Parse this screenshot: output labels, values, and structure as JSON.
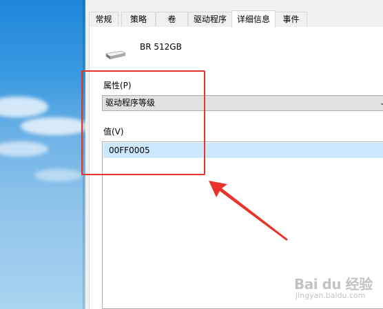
{
  "dialog": {
    "tabs": [
      {
        "label": "常规",
        "active": false
      },
      {
        "label": "策略",
        "active": false
      },
      {
        "label": "卷",
        "active": false
      },
      {
        "label": "驱动程序",
        "active": false
      },
      {
        "label": "详细信息",
        "active": true
      },
      {
        "label": "事件",
        "active": false
      }
    ],
    "device_name": "BR 512GB",
    "property_label": "属性(P)",
    "property_selected": "驱动程序等级",
    "value_label": "值(V)",
    "values": [
      "00FF0005"
    ]
  },
  "annotation": {
    "color": "#e8332a"
  },
  "watermark": {
    "logo": "Bai du 经验",
    "sub": "jingyan.baidu.com"
  },
  "colors": {
    "selection": "#cce8ff",
    "dialog_bg": "#f0f0f0"
  }
}
